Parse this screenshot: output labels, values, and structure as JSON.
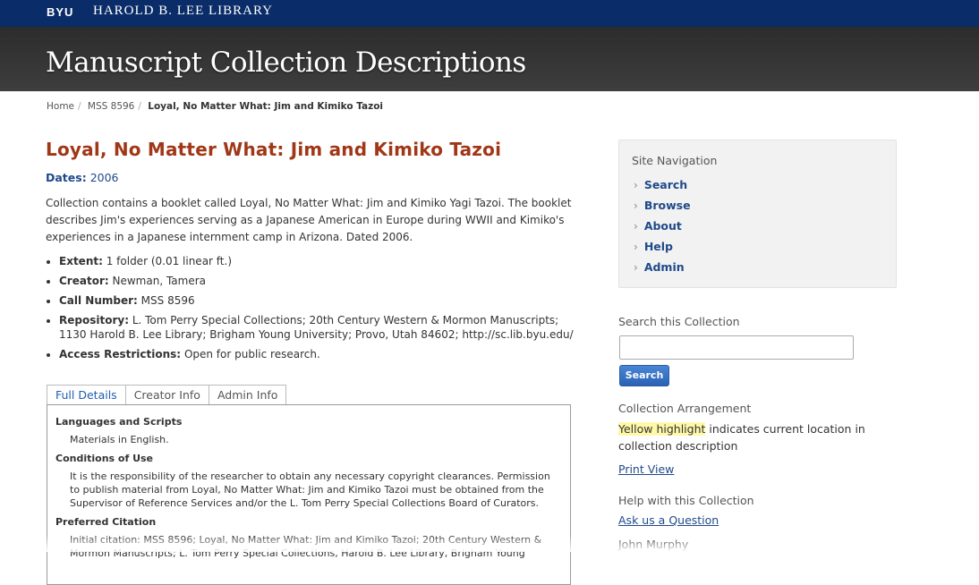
{
  "header": {
    "byu": "BYU",
    "library": "HAROLD B. LEE LIBRARY",
    "site_title": "Manuscript Collection Descriptions"
  },
  "breadcrumb": {
    "home": "Home",
    "collection": "MSS 8596",
    "current": "Loyal, No Matter What: Jim and Kimiko Tazoi"
  },
  "main": {
    "title": "Loyal, No Matter What: Jim and Kimiko Tazoi",
    "dates_label": "Dates:",
    "dates_value": "2006",
    "summary": "Collection contains a booklet called Loyal, No Matter What: Jim and Kimiko Yagi Tazoi. The booklet describes Jim's experiences serving as a Japanese American in Europe during WWII and Kimiko's experiences in a Japanese internment camp in Arizona. Dated 2006.",
    "meta": [
      {
        "label": "Extent:",
        "value": "1 folder (0.01 linear ft.)"
      },
      {
        "label": "Creator:",
        "value": "Newman, Tamera"
      },
      {
        "label": "Call Number:",
        "value": "MSS 8596"
      },
      {
        "label": "Repository:",
        "value": "L. Tom Perry Special Collections; 20th Century Western & Mormon Manuscripts; 1130 Harold B. Lee Library; Brigham Young University; Provo, Utah 84602; http://sc.lib.byu.edu/"
      },
      {
        "label": "Access Restrictions:",
        "value": "Open for public research."
      }
    ],
    "tabs": [
      "Full Details",
      "Creator Info",
      "Admin Info"
    ],
    "details": {
      "lang_heading": "Languages and Scripts",
      "lang_text": "Materials in English.",
      "use_heading": "Conditions of Use",
      "use_text": "It is the responsibility of the researcher to obtain any necessary copyright clearances. Permission to publish material from Loyal, No Matter What: Jim and Kimiko Tazoi must be obtained from the Supervisor of Reference Services and/or the L. Tom Perry Special Collections Board of Curators.",
      "cite_heading": "Preferred Citation",
      "cite_text": "Initial citation: MSS 8596; Loyal, No Matter What: Jim and Kimiko Tazoi; 20th Century Western & Mormon Manuscripts; L. Tom Perry Special Collections, Harold B. Lee Library, Brigham Young"
    }
  },
  "sidebar": {
    "nav_heading": "Site Navigation",
    "nav_items": [
      "Search",
      "Browse",
      "About",
      "Help",
      "Admin"
    ],
    "search_heading": "Search this Collection",
    "search_button": "Search",
    "arrangement_heading": "Collection Arrangement",
    "arrangement_highlight": "Yellow highlight",
    "arrangement_text": " indicates current location in collection description",
    "print_view": "Print View",
    "help_heading": "Help with this Collection",
    "ask_link": "Ask us a Question",
    "contact_name": "John Murphy"
  },
  "colors": {
    "topbar": "#0a2c68",
    "title": "#a03717",
    "link": "#1f4a8a",
    "highlight": "#fff8a8"
  }
}
